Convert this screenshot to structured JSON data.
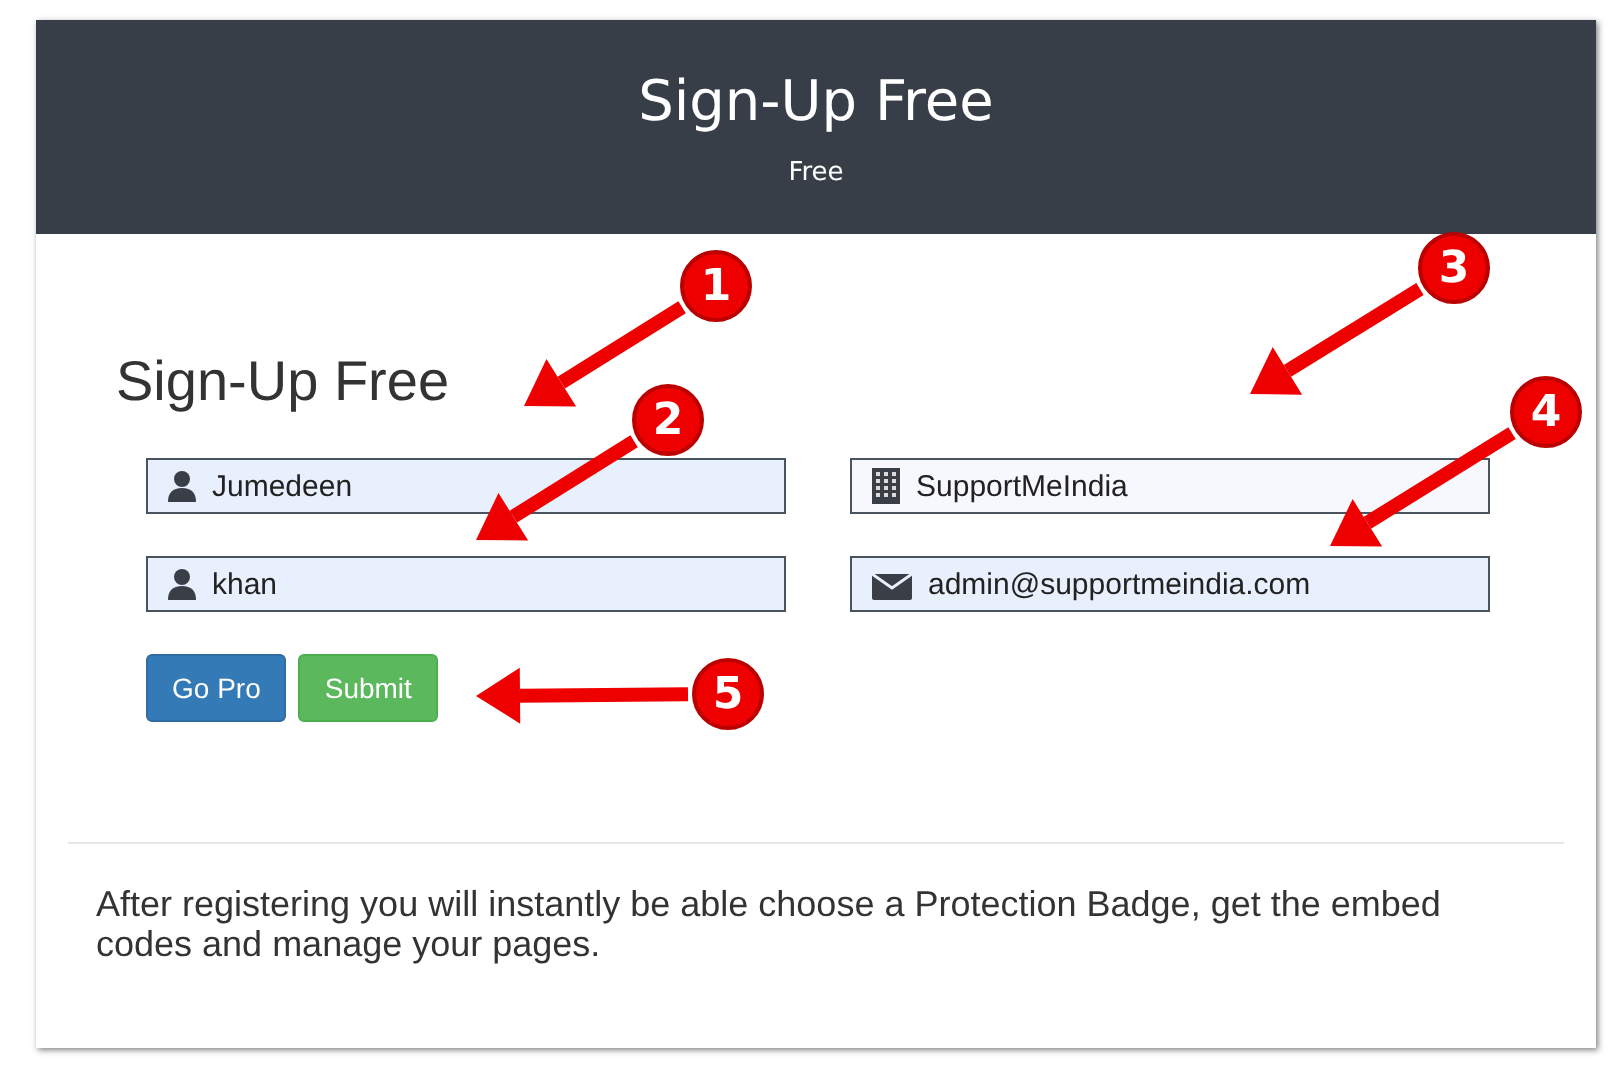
{
  "header": {
    "title": "Sign-Up Free",
    "subtitle": "Free"
  },
  "form": {
    "heading": "Sign-Up Free",
    "fields": [
      {
        "kind": "user",
        "value": "Jumedeen",
        "autofilled": true
      },
      {
        "kind": "building",
        "value": "SupportMeIndia",
        "autofilled": false
      },
      {
        "kind": "user",
        "value": "khan",
        "autofilled": true
      },
      {
        "kind": "envelope",
        "value": "admin@supportmeindia.com",
        "autofilled": true
      }
    ],
    "buttons": [
      {
        "label": "Go Pro",
        "kind": "primary"
      },
      {
        "label": "Submit",
        "kind": "success"
      }
    ]
  },
  "note": "After registering you will instantly be able choose a Protection Badge, get the embed codes and manage your pages.",
  "callouts": [
    "1",
    "2",
    "3",
    "4",
    "5"
  ]
}
